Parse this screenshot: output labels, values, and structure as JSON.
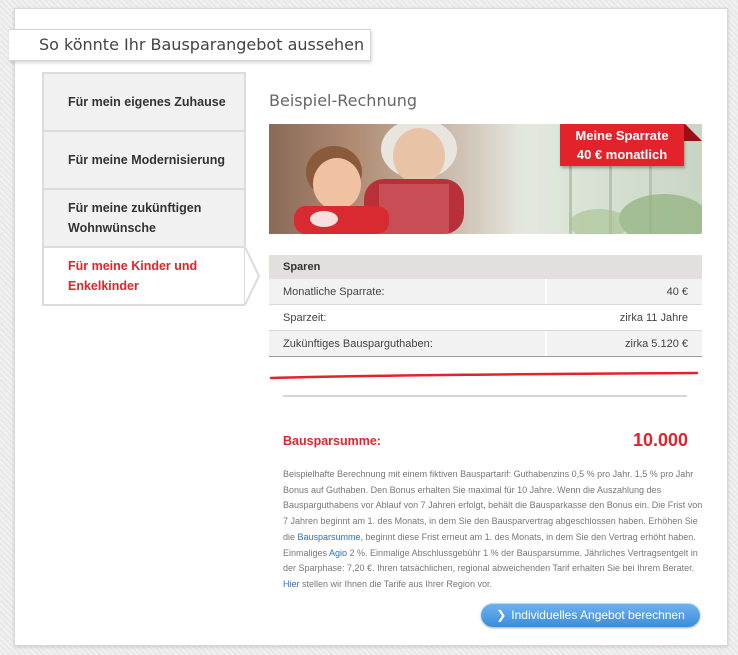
{
  "header": {
    "title": "So könnte Ihr Bausparangebot aussehen"
  },
  "nav": {
    "items": [
      {
        "label": "Für mein eigenes Zuhause",
        "active": false
      },
      {
        "label": "Für meine Modernisierung",
        "active": false
      },
      {
        "label": "Für meine zukünftigen Wohnwünsche",
        "active": false
      },
      {
        "label": "Für meine Kinder und Enkelkinder",
        "active": true
      }
    ]
  },
  "main": {
    "section_title": "Beispiel-Rechnung",
    "badge": {
      "line1": "Meine Sparrate",
      "line2": "40 € monatlich"
    },
    "table": {
      "header": "Sparen",
      "rows": [
        {
          "label": "Monatliche Sparrate:",
          "value": "40 €"
        },
        {
          "label": "Sparzeit:",
          "value": "zirka 11 Jahre"
        },
        {
          "label": "Zukünftiges Bausparguthaben:",
          "value": "zirka 5.120 €"
        }
      ]
    },
    "sum": {
      "label": "Bausparsumme:",
      "value": "10.000"
    },
    "info": {
      "part1": "Beispielhafte Berechnung mit einem fiktiven Bauspartarif: Guthabenzins 0,5 % pro Jahr. 1,5 % pro Jahr Bonus auf Guthaben. Den Bonus erhalten Sie maximal für 10 Jahre. Wenn die Auszahlung des Bausparguthabens vor Ablauf von 7 Jahren erfolgt, behält die Bausparkasse den Bonus ein. Die Frist von 7 Jahren beginnt am 1. des Monats, in dem Sie den Bausparvertrag abgeschlossen haben. Erhöhen Sie die ",
      "link1": "Bausparsumme",
      "part2": ", beginnt diese Frist erneut am 1. des Monats, in dem Sie den Vertrag erhöht haben. Einmaliges ",
      "link2": "Agio",
      "part3": " 2 %. Einmalige Abschlussgebühr 1 % der Bausparsumme. Jährliches Vertragsentgelt in der Sparphase: 7,20 €. Ihren tatsächlichen, regional abweichenden Tarif erhalten Sie bei Ihrem Berater. ",
      "link3": "Hier",
      "part4": " stellen wir Ihnen die Tarife aus Ihrer Region vor."
    },
    "cta_label": "Individuelles Angebot berechnen"
  },
  "colors": {
    "accent_red": "#e2232b",
    "cta_blue": "#3a8ddb",
    "link_blue": "#2a6fc0"
  },
  "icons": {
    "cta": "chevron-right-icon"
  }
}
